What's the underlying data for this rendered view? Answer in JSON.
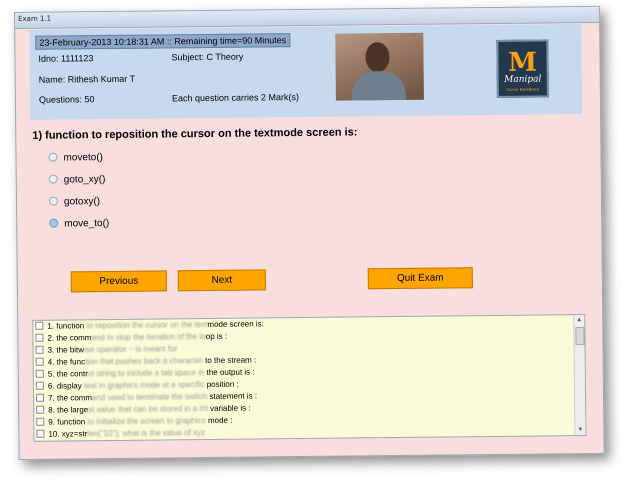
{
  "window": {
    "title": "Exam 1.1"
  },
  "header": {
    "datetime": "23-February-2013 10:18:31 AM :: Remaining time=90 Minutes",
    "idno": "Idno: 1111123",
    "subject": "Subject: C Theory",
    "name": "Name: Rithesh Kumar  T",
    "questions": "Questions: 50",
    "marks": "Each question carries 2 Mark(s)",
    "logo": {
      "mark": "M",
      "wordmark": "Manipal",
      "tagline": "Career Excellence"
    }
  },
  "question": {
    "text": "1)   function to reposition the cursor on the textmode screen is:",
    "options": [
      "moveto()",
      "goto_xy()",
      "gotoxy()",
      "move_to()"
    ],
    "selected_index": 3
  },
  "buttons": {
    "previous": "Previous",
    "next": "Next",
    "quit": "Quit Exam"
  },
  "question_list": [
    {
      "num": "1.",
      "visible": "function",
      "blurred": " to reposition the cursor on the text",
      "end": "mode screen is:"
    },
    {
      "num": "2.",
      "visible": "the comm",
      "blurred": "and to stop the iteration of the lo",
      "end": "op is :"
    },
    {
      "num": "3.",
      "visible": "the bitw",
      "blurred": "ise operator ~ is meant for",
      "end": ""
    },
    {
      "num": "4.",
      "visible": "the func",
      "blurred": "tion that pushes back a character",
      "end": " to the stream :"
    },
    {
      "num": "5.",
      "visible": "the contr",
      "blurred": "ol string to include a tab space in",
      "end": " the output is :"
    },
    {
      "num": "6.",
      "visible": "display ",
      "blurred": "text in graphics mode at a specific",
      "end": " position :"
    },
    {
      "num": "7.",
      "visible": "the comm",
      "blurred": "and used to terminate the switch",
      "end": " statement is :"
    },
    {
      "num": "8.",
      "visible": "the large",
      "blurred": "st value that can be stored in a int",
      "end": " variable is :"
    },
    {
      "num": "9.",
      "visible": "function",
      "blurred": " to initialize the screen to graphics",
      "end": " mode :"
    },
    {
      "num": "10.",
      "visible": "xyz=str",
      "blurred": "len(\"10\"); what is the value of xyz",
      "end": ""
    }
  ],
  "colors": {
    "background": "#f9dede",
    "header": "#c6d9ee",
    "button": "#ffa500",
    "list": "#fbfbd8"
  },
  "icons": {
    "scroll_up": "scroll-up-icon",
    "scroll_down": "scroll-down-icon"
  }
}
